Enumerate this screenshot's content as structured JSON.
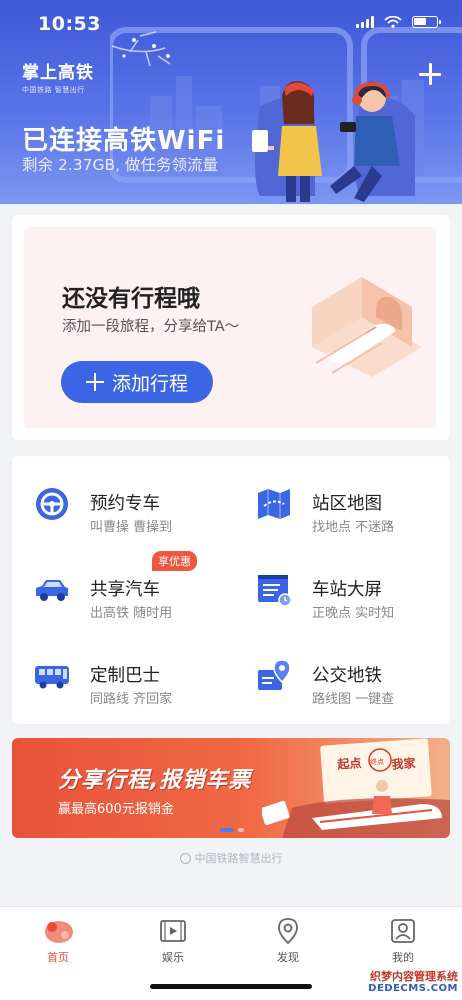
{
  "status_bar": {
    "time": "10:53"
  },
  "header": {
    "brand_name": "掌上高铁",
    "brand_sub": "中国铁路 智慧出行",
    "wifi_title": "已连接高铁WiFi",
    "wifi_sub": "剩余 2.37GB, 做任务领流量"
  },
  "trip": {
    "title": "还没有行程哦",
    "subtitle": "添加一段旅程，分享给TA～",
    "add_button": "添加行程"
  },
  "services": [
    {
      "title": "预约专车",
      "sub": "叫曹操 曹操到",
      "icon": "steering-wheel-icon"
    },
    {
      "title": "站区地图",
      "sub": "找地点 不迷路",
      "icon": "map-icon"
    },
    {
      "title": "共享汽车",
      "sub": "出高铁 随时用",
      "icon": "car-icon",
      "badge": "享优惠"
    },
    {
      "title": "车站大屏",
      "sub": "正晚点 实时知",
      "icon": "screen-icon"
    },
    {
      "title": "定制巴士",
      "sub": "同路线 齐回家",
      "icon": "bus-icon"
    },
    {
      "title": "公交地铁",
      "sub": "路线图 一键查",
      "icon": "location-icon"
    }
  ],
  "banner": {
    "title": "分享行程,报销车票",
    "subtitle": "赢最高600元报销金",
    "sign_1": "起点",
    "sign_2": "我家",
    "sign_3": "终点",
    "dots_total": 3,
    "dots_active": 2
  },
  "footer_note": "中国铁路智慧出行",
  "tabs": [
    {
      "label": "首页",
      "active": true
    },
    {
      "label": "娱乐",
      "active": false
    },
    {
      "label": "发现",
      "active": false
    },
    {
      "label": "我的",
      "active": false
    }
  ],
  "watermark": {
    "line1": "织梦内容管理系统",
    "line2": "DEDECMS.COM"
  },
  "colors": {
    "primary": "#3a66e3",
    "accent": "#e94d3a",
    "header": "#4a63de"
  }
}
